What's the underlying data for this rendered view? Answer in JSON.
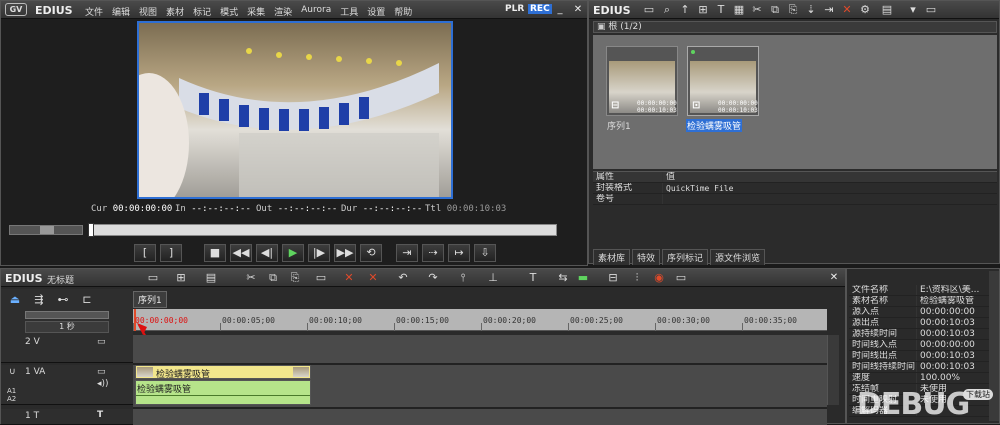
{
  "player": {
    "brand": "EDIUS",
    "menu": [
      "文件",
      "编辑",
      "视图",
      "素材",
      "标记",
      "模式",
      "采集",
      "渲染",
      "Aurora",
      "工具",
      "设置",
      "帮助"
    ],
    "plr": "PLR",
    "rec": "REC",
    "cur_label": "Cur",
    "cur_value": "00:00:00:00",
    "in_label": "In",
    "in_value": "--:--:--:--",
    "out_label": "Out",
    "out_value": "--:--:--:--",
    "dur_label": "Dur",
    "dur_value": "--:--:--:--",
    "ttl_label": "Ttl",
    "ttl_value": "00:00:10:03"
  },
  "bin": {
    "brand": "EDIUS",
    "folder_label": "根 (1/2)",
    "clips": [
      {
        "name": "序列1",
        "tc1": "00:00:00:00",
        "tc2": "00:00:10:03",
        "selected": false
      },
      {
        "name": "检验螨雾吸管",
        "tc1": "00:00:00:00",
        "tc2": "00:00:10:03",
        "selected": true
      }
    ],
    "prop_header_key": "属性",
    "prop_header_val": "值",
    "props": [
      {
        "k": "封装格式",
        "v": "QuickTime File"
      },
      {
        "k": "卷号",
        "v": ""
      }
    ],
    "tabs": [
      "素材库",
      "特效",
      "序列标记",
      "源文件浏览"
    ]
  },
  "timeline": {
    "brand": "EDIUS",
    "project_name": "无标题",
    "zoom_label": "1 秒",
    "sequence_tab": "序列1",
    "ruler": [
      "00:00:00;00",
      "00:00:05;00",
      "00:00:10;00",
      "00:00:15;00",
      "00:00:20;00",
      "00:00:25;00",
      "00:00:30;00",
      "00:00:35;00"
    ],
    "tracks": [
      {
        "name": "2 V"
      },
      {
        "name": "1 VA"
      },
      {
        "name": "1 T"
      }
    ],
    "clip_video_label": "检验螨雾吸管",
    "clip_audio_label": "检验螨雾吸管",
    "a_labels": [
      "A1",
      "A2"
    ]
  },
  "info": {
    "rows": [
      {
        "k": "文件名称",
        "v": "E:\\资料区\\美..."
      },
      {
        "k": "素材名称",
        "v": "检验螨雾吸管"
      },
      {
        "k": "源入点",
        "v": "00:00:00:00"
      },
      {
        "k": "源出点",
        "v": "00:00:10:03"
      },
      {
        "k": "源持续时间",
        "v": "00:00:10:03"
      },
      {
        "k": "时间线入点",
        "v": "00:00:00:00"
      },
      {
        "k": "时间线出点",
        "v": "00:00:10:03"
      },
      {
        "k": "时间线持续时间",
        "v": "00:00:10:03"
      },
      {
        "k": "速度",
        "v": "100.00%"
      },
      {
        "k": "冻结帧",
        "v": "未使用"
      },
      {
        "k": "时间重映射",
        "v": "未使用"
      },
      {
        "k": "编解码器",
        "v": ""
      }
    ],
    "watermark": "DEBUG",
    "watermark_sub": "下载站"
  },
  "colors": {
    "accent": "#2e6fd4",
    "play": "#5fd45f",
    "clip_video": "#f2e68c",
    "clip_audio": "#b6e48a"
  }
}
